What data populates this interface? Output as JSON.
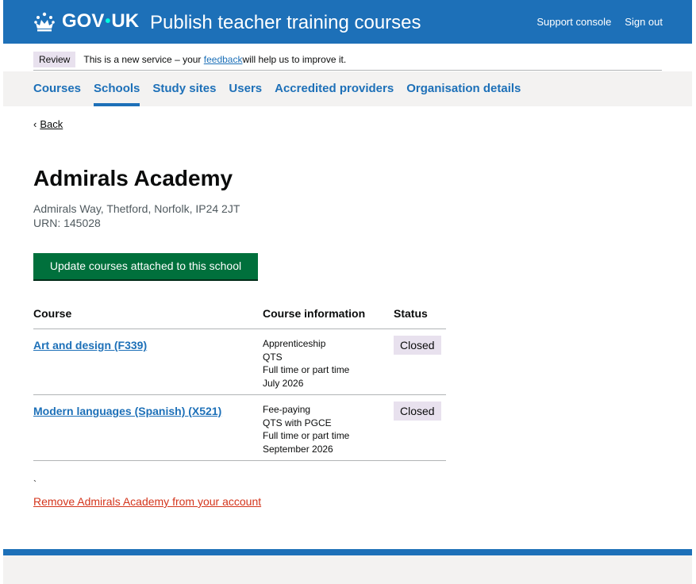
{
  "header": {
    "logo_text": "GOV",
    "logo_text2": "UK",
    "service_name": "Publish teacher training courses",
    "links": [
      "Support console",
      "Sign out"
    ]
  },
  "phase_banner": {
    "tag": "Review",
    "text_before": "This is a new service – your ",
    "link": "feedback",
    "text_after": " will help us to improve it."
  },
  "primary_nav": {
    "items": [
      "Courses",
      "Schools",
      "Study sites",
      "Users",
      "Accredited providers",
      "Organisation details"
    ],
    "active": "Schools"
  },
  "back_link": "Back",
  "school": {
    "name": "Admirals Academy",
    "address": "Admirals Way, Thetford, Norfolk, IP24 2JT",
    "urn": "URN: 145028"
  },
  "update_button": "Update courses attached to this school",
  "table": {
    "headers": [
      "Course",
      "Course information",
      "Status"
    ],
    "rows": [
      {
        "course": "Art and design (F339)",
        "info": [
          "Apprenticeship",
          "QTS",
          "Full time or part time",
          "July 2026"
        ],
        "status": "Closed"
      },
      {
        "course": "Modern languages (Spanish) (X521)",
        "info": [
          "Fee-paying",
          "QTS with PGCE",
          "Full time or part time",
          "September 2026"
        ],
        "status": "Closed"
      }
    ]
  },
  "stray_mark": "`",
  "remove_link": "Remove Admirals Academy from your account",
  "colors": {
    "header_blue": "#1d70b8",
    "button_green": "#00703c",
    "warning_red": "#d4351c",
    "tag_purple_bg": "#e8e1ee"
  }
}
